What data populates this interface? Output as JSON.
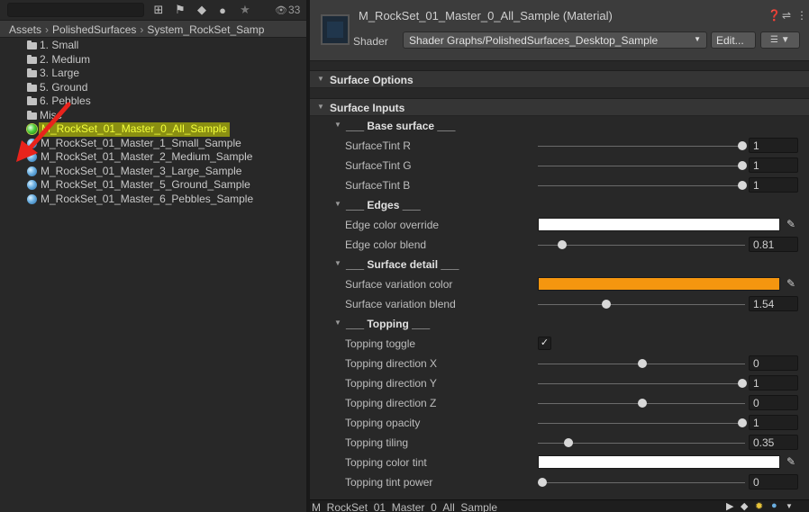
{
  "project": {
    "hidden_count": "33",
    "breadcrumb": [
      "Assets",
      "PolishedSurfaces",
      "System_RockSet_Samp"
    ],
    "folders": [
      {
        "label": "1. Small"
      },
      {
        "label": "2. Medium"
      },
      {
        "label": "3. Large"
      },
      {
        "label": "5. Ground"
      },
      {
        "label": "6. Pebbles"
      },
      {
        "label": "Misc"
      }
    ],
    "assets": [
      {
        "label": "M_RockSet_01_Master_0_All_Sample",
        "selected": true
      },
      {
        "label": "M_RockSet_01_Master_1_Small_Sample"
      },
      {
        "label": "M_RockSet_01_Master_2_Medium_Sample"
      },
      {
        "label": "M_RockSet_01_Master_3_Large_Sample"
      },
      {
        "label": "M_RockSet_01_Master_5_Ground_Sample"
      },
      {
        "label": "M_RockSet_01_Master_6_Pebbles_Sample"
      }
    ]
  },
  "inspector": {
    "title": "M_RockSet_01_Master_0_All_Sample (Material)",
    "shader_label": "Shader",
    "shader_value": "Shader Graphs/PolishedSurfaces_Desktop_Sample",
    "edit_label": "Edit...",
    "sections": {
      "surface_options": "Surface Options",
      "surface_inputs": "Surface Inputs"
    },
    "groups": {
      "base_surface": "___ Base surface ___",
      "edges": "___ Edges ___",
      "surface_detail": "___ Surface detail ___",
      "topping": "___ Topping ___"
    },
    "props": {
      "tint_r": {
        "label": "SurfaceTint R",
        "value": "1",
        "level": 1.0
      },
      "tint_g": {
        "label": "SurfaceTint G",
        "value": "1",
        "level": 1.0
      },
      "tint_b": {
        "label": "SurfaceTint B",
        "value": "1",
        "level": 1.0
      },
      "edge_override": {
        "label": "Edge color override",
        "color": "#ffffff"
      },
      "edge_blend": {
        "label": "Edge color blend",
        "value": "0.81",
        "level": 0.1
      },
      "var_color": {
        "label": "Surface variation color",
        "color": "#f5960f"
      },
      "var_blend": {
        "label": "Surface variation blend",
        "value": "1.54",
        "level": 0.32
      },
      "topping_toggle": {
        "label": "Topping toggle",
        "checked": "✓"
      },
      "dir_x": {
        "label": "Topping direction X",
        "value": "0",
        "level": 0.5
      },
      "dir_y": {
        "label": "Topping direction Y",
        "value": "1",
        "level": 1.0
      },
      "dir_z": {
        "label": "Topping direction Z",
        "value": "0",
        "level": 0.5
      },
      "opacity": {
        "label": "Topping opacity",
        "value": "1",
        "level": 1.0
      },
      "tiling": {
        "label": "Topping tiling",
        "value": "0.35",
        "level": 0.13
      },
      "color_tint": {
        "label": "Topping color tint",
        "color": "#ffffff"
      },
      "tint_power": {
        "label": "Topping tint power",
        "value": "0",
        "level": 0.0
      }
    },
    "footer_title": "M_RockSet_01_Master_0_All_Sample"
  }
}
